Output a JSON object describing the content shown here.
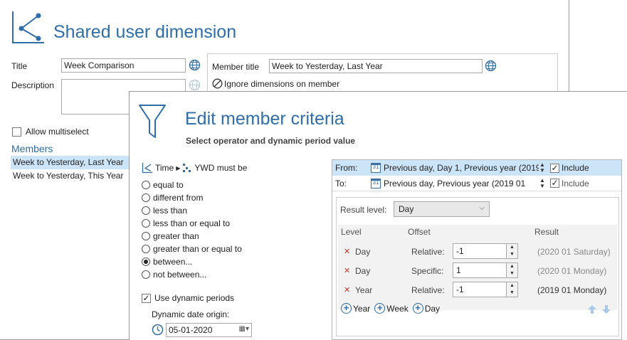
{
  "back": {
    "title": "Shared user dimension",
    "title_label": "Title",
    "title_value": "Week Comparison",
    "description_label": "Description",
    "member_title_label": "Member title",
    "member_title_value": "Week to Yesterday, Last Year",
    "ignore_label": "Ignore dimensions on member",
    "allow_multiselect_label": "Allow multiselect",
    "members_heading": "Members",
    "members": [
      {
        "label": "Week to Yesterday, Last Year",
        "selected": true
      },
      {
        "label": "Week to Yesterday, This Year",
        "selected": false
      }
    ]
  },
  "edit": {
    "title": "Edit member criteria",
    "subtitle": "Select operator and dynamic period value",
    "crumb_time": "Time",
    "crumb_ywd": "YWD must be",
    "operators": [
      {
        "label": "equal to",
        "checked": false
      },
      {
        "label": "different from",
        "checked": false
      },
      {
        "label": "less than",
        "checked": false
      },
      {
        "label": "less than or equal to",
        "checked": false
      },
      {
        "label": "greater than",
        "checked": false
      },
      {
        "label": "greater than or equal to",
        "checked": false
      },
      {
        "label": "between...",
        "checked": true
      },
      {
        "label": "not between...",
        "checked": false
      }
    ],
    "use_dynamic_label": "Use dynamic periods",
    "use_dynamic_checked": true,
    "origin_label": "Dynamic date origin:",
    "origin_value": "05-01-2020"
  },
  "period": {
    "from_label": "From:",
    "from_value": "Previous day, Day 1, Previous year (2019",
    "from_include": "Include",
    "to_label": "To:",
    "to_value": "Previous day, Previous year (2019 01",
    "to_include": "Include",
    "result_level_label": "Result level:",
    "result_level_value": "Day",
    "col_level": "Level",
    "col_offset": "Offset",
    "col_result": "Result",
    "rows": [
      {
        "level": "Day",
        "mode": "Relative:",
        "value": "-1",
        "result": "(2020 01 Saturday)"
      },
      {
        "level": "Day",
        "mode": "Specific:",
        "value": "1",
        "result": "(2020 01 Monday)"
      },
      {
        "level": "Year",
        "mode": "Relative:",
        "value": "-1",
        "result": "(2019 01 Monday)"
      }
    ],
    "add_year": "Year",
    "add_week": "Week",
    "add_day": "Day"
  },
  "colors": {
    "accent": "#2f6ea8",
    "selection": "#cce4f7",
    "remove": "#d23b2b"
  }
}
